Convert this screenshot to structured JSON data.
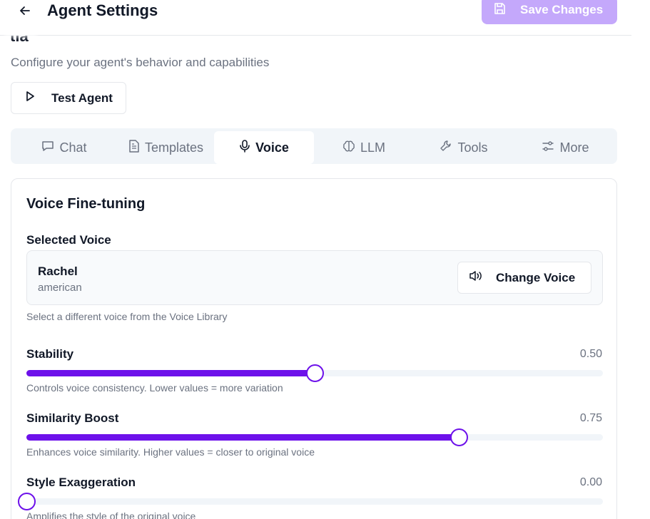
{
  "header": {
    "title": "Agent Settings",
    "save_label": "Save Changes"
  },
  "agent": {
    "name_fragment": "tia",
    "subtitle": "Configure your agent's behavior and capabilities",
    "test_label": "Test Agent"
  },
  "tabs": [
    {
      "label": "Chat",
      "icon": "chat-bubble-icon"
    },
    {
      "label": "Templates",
      "icon": "document-icon"
    },
    {
      "label": "Voice",
      "icon": "microphone-icon",
      "active": true
    },
    {
      "label": "LLM",
      "icon": "brain-icon"
    },
    {
      "label": "Tools",
      "icon": "wrench-icon"
    },
    {
      "label": "More",
      "icon": "sliders-icon"
    }
  ],
  "voice_panel": {
    "title": "Voice Fine-tuning",
    "selected_label": "Selected Voice",
    "voice_name": "Rachel",
    "voice_accent": "american",
    "change_label": "Change Voice",
    "helper": "Select a different voice from the Voice Library"
  },
  "sliders": [
    {
      "label": "Stability",
      "value": 0.5,
      "display": "0.50",
      "helper": "Controls voice consistency. Lower values = more variation"
    },
    {
      "label": "Similarity Boost",
      "value": 0.75,
      "display": "0.75",
      "helper": "Enhances voice similarity. Higher values = closer to original voice"
    },
    {
      "label": "Style Exaggeration",
      "value": 0.0,
      "display": "0.00",
      "helper": "Amplifies the style of the original voice"
    }
  ],
  "colors": {
    "accent": "#6d11ea",
    "save_button": "#c4a8fb"
  }
}
